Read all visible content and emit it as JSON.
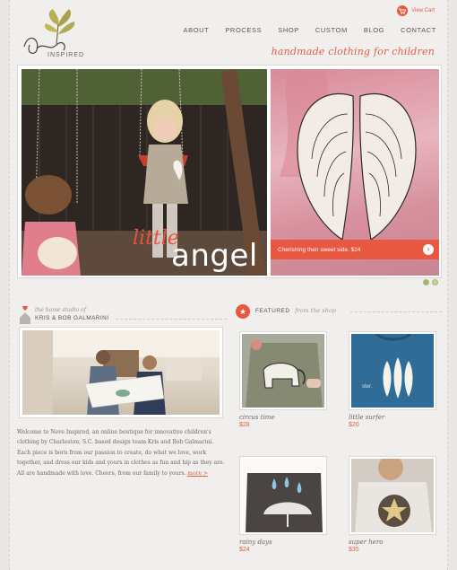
{
  "header": {
    "logo_text": "INSPIRED",
    "cart_label": "View Cart",
    "nav": [
      "ABOUT",
      "PROCESS",
      "SHOP",
      "CUSTOM",
      "BLOG",
      "CONTACT"
    ],
    "tagline": "handmade clothing for children"
  },
  "hero": {
    "script_word": "little",
    "main_word": "angel",
    "caption": "Cherishing their sweet side. $24"
  },
  "studio": {
    "subtitle": "the home studio of",
    "names": "KRIS & BOB GALMARINI",
    "intro": "Welcome to Neve Inspired, an online boutique for innovative children's clothing by Charleston, S.C. based design team Kris and Bob Galmarini. Each piece is born from our passion to create, do what we love, work together, and dress our kids and yours in clothes as fun and hip as they are. All are handmade with love. Cheers, from our family to yours.",
    "more_label": "more >"
  },
  "featured": {
    "title": "FEATURED",
    "subtitle": "from the shop",
    "products": [
      {
        "name": "circus time",
        "price": "$28"
      },
      {
        "name": "little surfer",
        "price": "$20"
      },
      {
        "name": "rainy days",
        "price": "$24"
      },
      {
        "name": "super hero",
        "price": "$35"
      }
    ]
  },
  "colors": {
    "accent": "#e8573f",
    "background": "#f1efed"
  }
}
